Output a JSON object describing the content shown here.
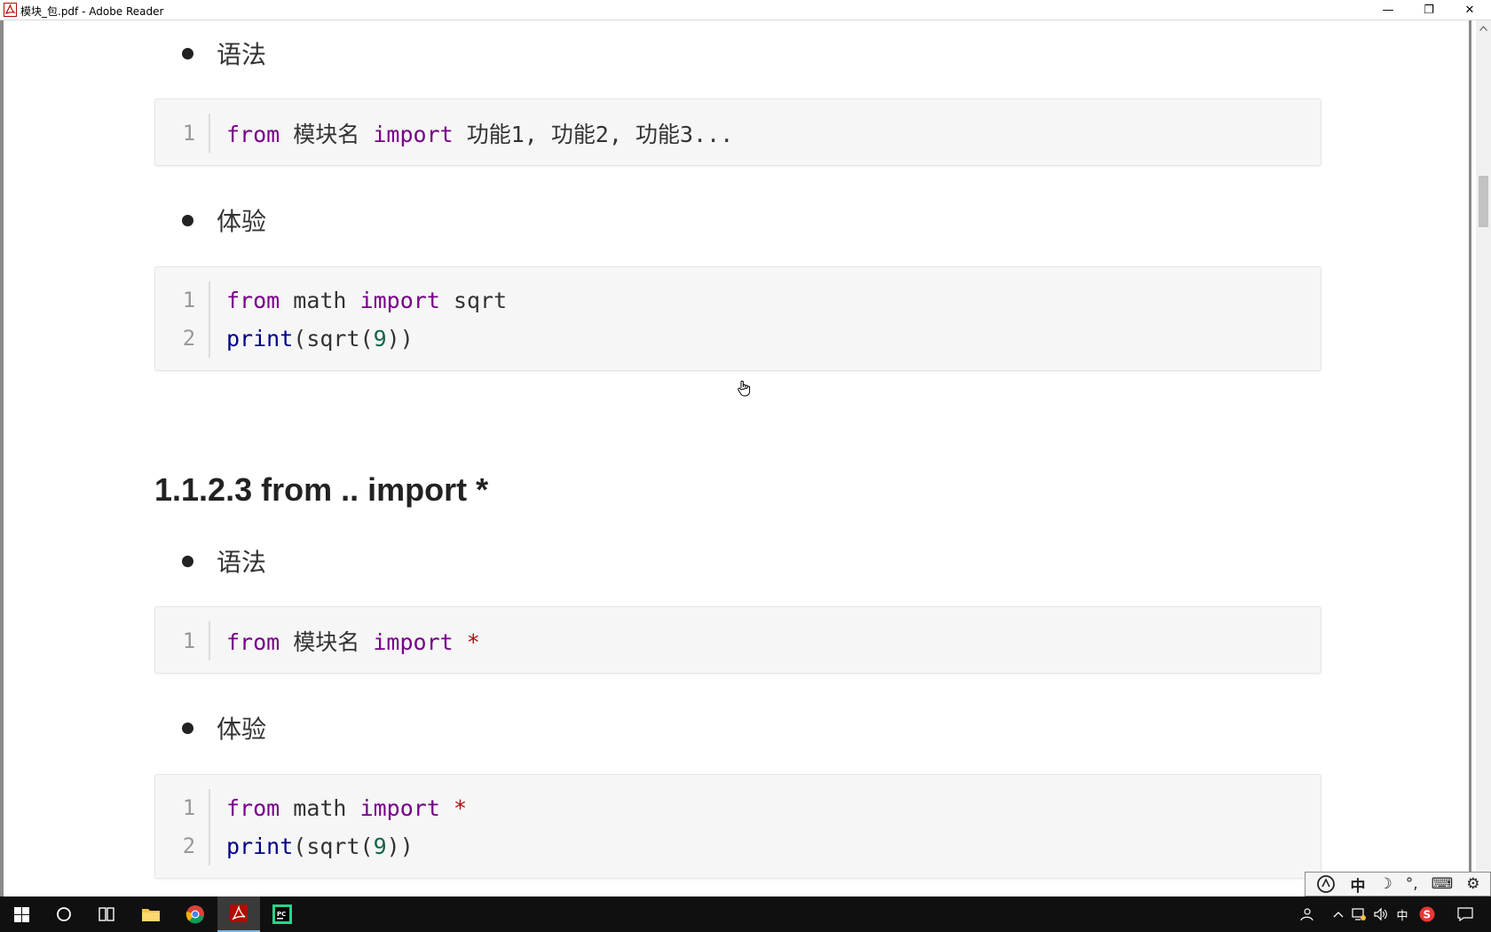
{
  "window": {
    "title": "模块_包.pdf - Adobe Reader",
    "minimize_glyph": "—",
    "maximize_glyph": "❐",
    "close_glyph": "✕"
  },
  "document": {
    "blocks": [
      {
        "bullet": "语法",
        "code": [
          {
            "no": "1"
          }
        ]
      },
      {
        "bullet": "体验"
      },
      {
        "bullet": "语法"
      },
      {
        "bullet": "体验"
      }
    ],
    "heading": "1.1.2.3 from .. import *",
    "code_tokens": {
      "from": "from",
      "import": "import",
      "module": "模块名",
      "features": "功能1, 功能2, 功能3...",
      "math": "math",
      "sqrt": "sqrt",
      "print": "print",
      "open": "(",
      "close": ")",
      "nine": "9",
      "star": "*",
      "l1": "1",
      "l2": "2"
    }
  },
  "ime": {
    "mode": "中",
    "moon": "☽",
    "punct": "°,",
    "keyboard": "⌨",
    "settings": "⚙"
  },
  "taskbar": {
    "tray_lang": "中",
    "tray_brand": "S"
  }
}
